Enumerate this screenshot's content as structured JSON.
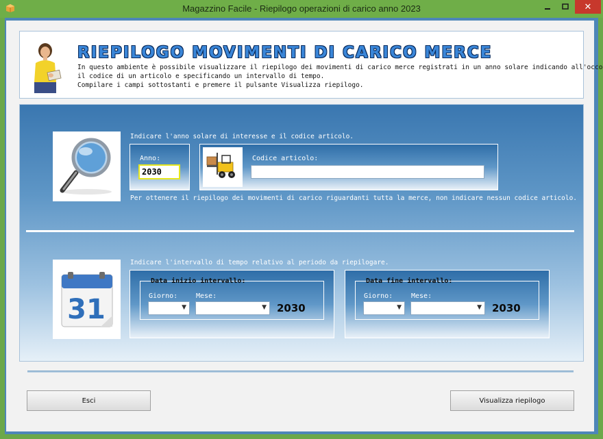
{
  "window": {
    "title": "Magazzino Facile - Riepilogo operazioni di carico anno 2023",
    "close_glyph": "✕"
  },
  "header": {
    "title": "RIEPILOGO MOVIMENTI DI CARICO MERCE",
    "desc_lines": [
      "In questo ambiente è possibile visualizzare il riepilogo dei movimenti di carico merce registrati in un anno solare indicando all'occorrenza",
      "il codice di un articolo e specificando un intervallo di tempo.",
      "Compilare i campi sottostanti e premere il pulsante Visualizza riepilogo."
    ]
  },
  "search_section": {
    "instruction": "Indicare l'anno solare di interesse e il codice articolo.",
    "anno_label": "Anno:",
    "anno_value": "2030",
    "codice_label": "Codice articolo:",
    "codice_value": "",
    "hint": "Per ottenere il riepilogo dei movimenti di carico riguardanti tutta la merce, non indicare nessun codice articolo."
  },
  "interval_section": {
    "instruction": "Indicare l'intervallo di tempo relativo al periodo da riepilogare.",
    "calendar_day": "31",
    "start": {
      "title": "Data inizio intervallo:",
      "giorno_label": "Giorno:",
      "mese_label": "Mese:",
      "giorno_value": "",
      "mese_value": "",
      "year": "2030"
    },
    "end": {
      "title": "Data fine intervallo:",
      "giorno_label": "Giorno:",
      "mese_label": "Mese:",
      "giorno_value": "",
      "mese_value": "",
      "year": "2030"
    }
  },
  "buttons": {
    "esci": "Esci",
    "visualizza": "Visualizza riepilogo"
  },
  "colors": {
    "titlebar": "#6fae48",
    "accent_blue": "#3a86d8",
    "close_red": "#c7382c"
  }
}
